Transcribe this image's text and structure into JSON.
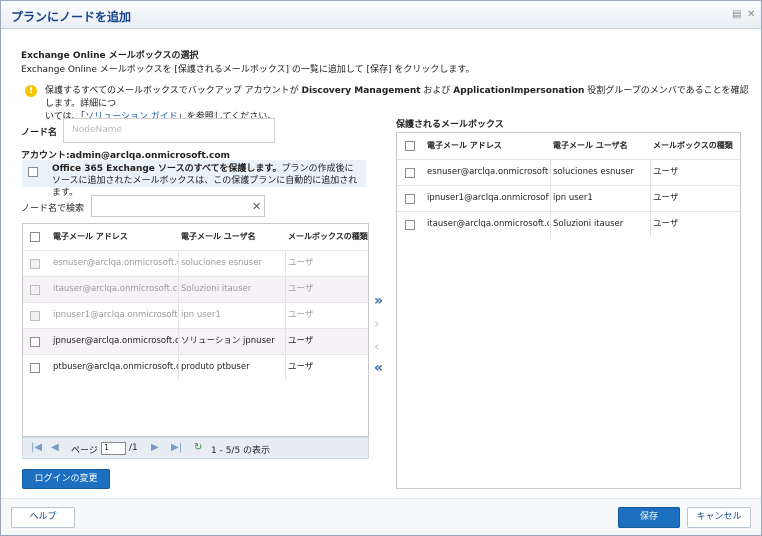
{
  "window": {
    "title": "プランにノードを追加"
  },
  "section": {
    "title": "Exchange Online メールボックスの選択",
    "description": "Exchange Online メールボックスを [保護されるメールボックス] の一覧に追加して [保存] をクリックします。"
  },
  "note": {
    "line1_pre": "保護するすべてのメールボックスでバックアップ アカウントが ",
    "role1": "Discovery Management",
    "line1_mid": " および ",
    "role2": "ApplicationImpersonation",
    "line1_post": " 役割グループのメンバであることを確認します。詳細につ",
    "line2_pre": "いては、「",
    "link": "ソリューション ガイド",
    "line2_post": "」を参照してください。"
  },
  "node": {
    "label": "ノード名",
    "placeholder": "NodeName"
  },
  "account": {
    "text": "アカウント:admin@arclqa.onmicrosoft.com"
  },
  "protect_all": {
    "bold": "Office 365 Exchange ソースのすべてを保護します。",
    "rest": "プランの作成後にソースに追加されたメールボックスは、この保護プランに自動的に追加されます。"
  },
  "search": {
    "label": "ノード名で検索",
    "value": ""
  },
  "left_grid": {
    "headers": [
      "電子メール アドレス",
      "電子メール ユーザ名",
      "メールボックスの種類"
    ],
    "rows": [
      {
        "email": "esnuser@arclqa.onmicrosoft.c",
        "user": "soluciones esnuser",
        "type": "ユーザ",
        "disabled": true
      },
      {
        "email": "itauser@arclqa.onmicrosoft.co",
        "user": "Soluzioni itauser",
        "type": "ユーザ",
        "disabled": true
      },
      {
        "email": "ipnuser1@arclqa.onmicrosoft.",
        "user": "ipn user1",
        "type": "ユーザ",
        "disabled": true
      },
      {
        "email": "jpnuser@arclqa.onmicrosoft.c",
        "user": "ソリューション jpnuser",
        "type": "ユーザ",
        "disabled": false
      },
      {
        "email": "ptbuser@arclqa.onmicrosoft.co",
        "user": "produto ptbuser",
        "type": "ユーザ",
        "disabled": false
      }
    ]
  },
  "pager": {
    "page_label": "ページ",
    "page": "1",
    "of": "/1",
    "summary": "1 - 5/5 の表示"
  },
  "right_grid": {
    "title": "保護されるメールボックス",
    "headers": [
      "電子メール アドレス",
      "電子メール ユーザ名",
      "メールボックスの種類"
    ],
    "rows": [
      {
        "email": "esnuser@arclqa.onmicrosoft.c",
        "user": "soluciones esnuser",
        "type": "ユーザ"
      },
      {
        "email": "ipnuser1@arclqa.onmicrosoft.",
        "user": "ipn user1",
        "type": "ユーザ"
      },
      {
        "email": "itauser@arclqa.onmicrosoft.co",
        "user": "Soluzioni itauser",
        "type": "ユーザ"
      }
    ]
  },
  "arrows": {
    "add_all": "»",
    "add": "›",
    "remove": "‹",
    "remove_all": "«"
  },
  "buttons": {
    "change_login": "ログインの変更",
    "help": "ヘルプ",
    "save": "保存",
    "cancel": "キャンセル"
  },
  "icons": {
    "title_icon1": "▤",
    "title_icon2": "✕",
    "clear": "✕",
    "refresh": "↻"
  },
  "colors": {
    "primary": "#1d6fbf",
    "title": "#15428b",
    "link": "#1e5aa8",
    "warn": "#f5c400"
  }
}
